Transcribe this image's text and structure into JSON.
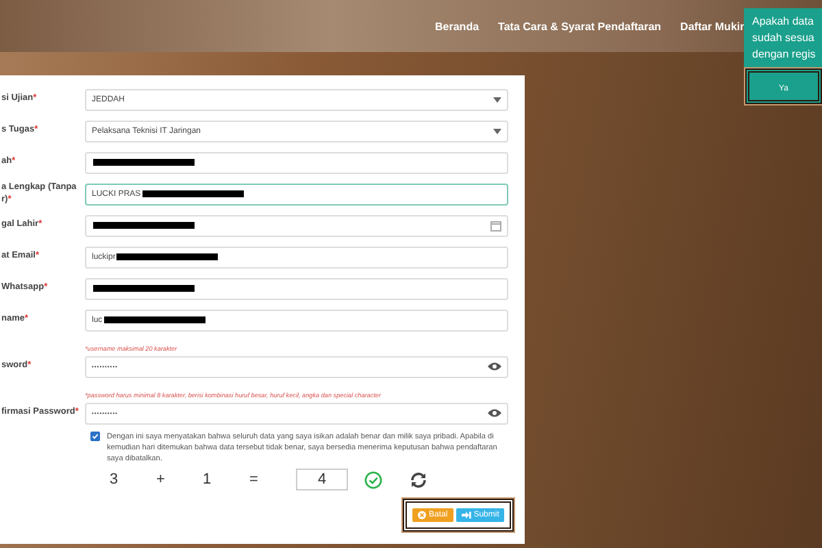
{
  "nav": {
    "items": [
      "Beranda",
      "Tata Cara & Syarat Pendaftaran",
      "Daftar Mukin"
    ]
  },
  "form": {
    "fields": [
      {
        "label": "si Ujian",
        "mark": "*",
        "kind": "select",
        "value": "JEDDAH",
        "redacted": false,
        "focused": false
      },
      {
        "label": "s Tugas",
        "mark": "*",
        "kind": "select",
        "value": "Pelaksana Teknisi IT Jaringan",
        "redacted": false,
        "focused": false
      },
      {
        "label": "ah",
        "mark": "*",
        "kind": "text",
        "redacted": true,
        "focused": false
      },
      {
        "label": "a Lengkap (Tanpa r)",
        "mark": "*",
        "kind": "text",
        "value": "LUCKI PRAS",
        "redacted": true,
        "focused": true
      },
      {
        "label": "gal Lahir",
        "mark": "*",
        "kind": "date",
        "redacted": true,
        "focused": false
      },
      {
        "label": "at Email",
        "mark": "*",
        "kind": "text",
        "value": "luckipr",
        "redacted": true,
        "focused": false
      },
      {
        "label": "Whatsapp",
        "mark": "*",
        "kind": "text",
        "redacted": true,
        "focused": false
      },
      {
        "label": "name",
        "mark": "*",
        "kind": "text",
        "value": "luc",
        "redacted": true,
        "focused": false,
        "hint": "*username maksimal 20 karakter"
      },
      {
        "label": "sword",
        "mark": "*",
        "kind": "password",
        "value": "••••••••••",
        "redacted": false,
        "focused": false,
        "hint": "*password harus minimal 8 karakter, berisi kombinasi huruf besar, huruf kecil, angka dan special character"
      },
      {
        "label": "firmasi Password",
        "mark": "*",
        "kind": "password",
        "value": "••••••••••",
        "redacted": false,
        "focused": false
      }
    ],
    "agreement": {
      "checked": true,
      "text": "Dengan ini saya menyatakan bahwa seluruh data yang saya isikan adalah benar dan milik saya pribadi. Apabila di kemudian hari ditemukan bahwa data tersebut tidak benar, saya bersedia menerima keputusan bahwa pendaftaran saya dibatalkan."
    },
    "captcha": {
      "a": "3",
      "op": "+",
      "b": "1",
      "eq": "=",
      "answer": "4",
      "valid": true
    },
    "buttons": [
      {
        "label": "Batal",
        "kind": "cancel"
      },
      {
        "label": "Submit",
        "kind": "submit"
      }
    ]
  },
  "popover": {
    "lines": [
      "Apakah data",
      "sudah sesua",
      "dengan regis"
    ],
    "button": "Ya"
  }
}
